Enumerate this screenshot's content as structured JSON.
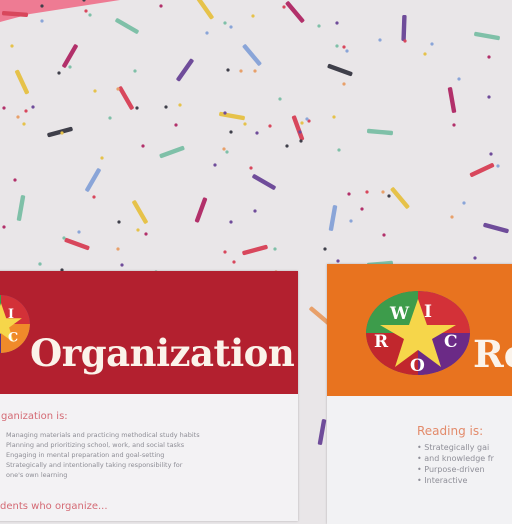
{
  "red_poster": {
    "logo_letters": [
      "I",
      "C"
    ],
    "title": "Organization",
    "subtitle": "ganization is:",
    "bullets": [
      "Managing materials and practicing methodical study habits",
      "Planning and prioritizing school, work, and social tasks",
      "Engaging in mental preparation and goal-setting",
      "Strategically and intentionally taking responsibility for",
      "one's own learning"
    ],
    "footer": "dents who organize..."
  },
  "orange_poster": {
    "logo_letters": [
      "W",
      "I",
      "R",
      "C",
      "O"
    ],
    "title": "Re",
    "subtitle": "Reading is:",
    "bullets": [
      "Strategically gai",
      "and knowledge fr",
      "Purpose-driven",
      "Interactive"
    ]
  },
  "colors": {
    "wall": "#e9e6e8",
    "red_header": "#b3202f",
    "orange_header": "#e8731f",
    "crayons": [
      "#d8475c",
      "#3f3f4a",
      "#7fc0a8",
      "#8aa5d8",
      "#e6c24a",
      "#b2306a",
      "#6f4c9a",
      "#e8a06a"
    ]
  }
}
